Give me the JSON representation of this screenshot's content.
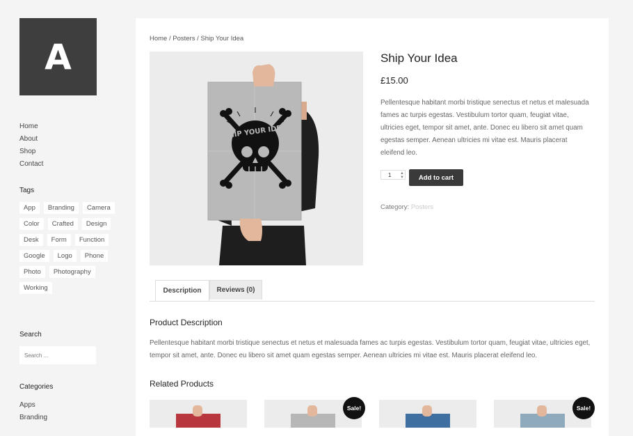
{
  "logo": {
    "letter": "A"
  },
  "nav": [
    "Home",
    "About",
    "Shop",
    "Contact"
  ],
  "tags_heading": "Tags",
  "tags": [
    "App",
    "Branding",
    "Camera",
    "Color",
    "Crafted",
    "Design",
    "Desk",
    "Form",
    "Function",
    "Google",
    "Logo",
    "Phone",
    "Photo",
    "Photography",
    "Working"
  ],
  "search": {
    "heading": "Search",
    "placeholder": "Search ..."
  },
  "categories": {
    "heading": "Categories",
    "items": [
      "Apps",
      "Branding"
    ]
  },
  "breadcrumb": {
    "home": "Home",
    "sep1": " / ",
    "section": "Posters",
    "sep2": " / ",
    "current": "Ship Your Idea"
  },
  "product": {
    "title": "Ship Your Idea",
    "price": "£15.00",
    "short_description": "Pellentesque habitant morbi tristique senectus et netus et malesuada fames ac turpis egestas. Vestibulum tortor quam, feugiat vitae, ultricies eget, tempor sit amet, ante. Donec eu libero sit amet quam egestas semper. Aenean ultricies mi vitae est. Mauris placerat eleifend leo.",
    "quantity": "1",
    "add_to_cart": "Add to cart",
    "category_label": "Category:",
    "category_value": "Posters",
    "poster_text": "SHIP YOUR IDEA"
  },
  "tabs": [
    "Description",
    "Reviews (0)"
  ],
  "description": {
    "heading": "Product Description",
    "text": "Pellentesque habitant morbi tristique senectus et netus et malesuada fames ac turpis egestas. Vestibulum tortor quam, feugiat vitae, ultricies eget, tempor sit amet, ante. Donec eu libero sit amet quam egestas semper. Aenean ultricies mi vitae est. Mauris placerat eleifend leo."
  },
  "related": {
    "heading": "Related Products",
    "sale_label": "Sale!",
    "items": [
      {
        "poster_color": "#b8373e",
        "sale": false
      },
      {
        "poster_color": "#b7b7b7",
        "sale": true
      },
      {
        "poster_color": "#3f6fa0",
        "sale": false
      },
      {
        "poster_color": "#8fa9bd",
        "sale": true
      }
    ]
  }
}
